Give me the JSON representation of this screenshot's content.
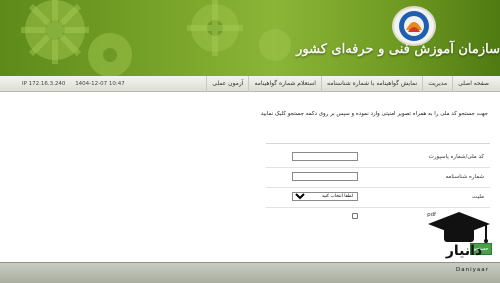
{
  "header": {
    "org_name": "سازمان آموزش فنی و حرفه‌ای کشور"
  },
  "nav": {
    "items": [
      {
        "label": "صفحه اصلی"
      },
      {
        "label": "مدیریت"
      },
      {
        "label": "نمایش گواهینامه با شماره شناسنامه"
      },
      {
        "label": "استعلام شماره گواهینامه"
      },
      {
        "label": "آزمون عملی"
      }
    ],
    "datetime": "1404-12-07 10:47",
    "ip": "IP 172.16.3.240"
  },
  "instruction": "جهت جستجو کد ملی را به همراه تصویر امنیتی وارد نموده و سپس بر روی دکمه جستجو کلیک نمایید",
  "form": {
    "national_code_label": "کد ملی/شماره پاسپورت",
    "national_code_value": "",
    "birth_cert_label": "شماره شناسنامه",
    "birth_cert_value": "",
    "nationality_label": "ملیت",
    "nationality_selected": "لطفا انتخاب کنید",
    "pdf_label": "pdf"
  },
  "search_button": "جستجو",
  "watermark": {
    "text": "دانیار",
    "sub": "Daniyaar"
  },
  "colors": {
    "header_green": "#7aa52a",
    "button_green": "#4aa04a"
  }
}
